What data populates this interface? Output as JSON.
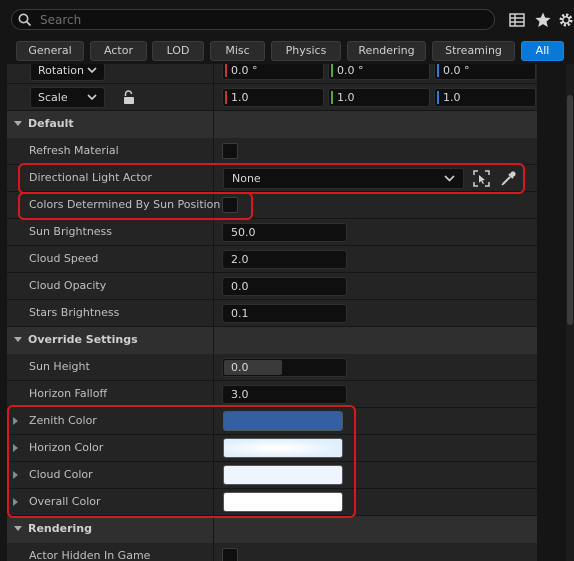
{
  "search": {
    "placeholder": "Search"
  },
  "tabs": [
    {
      "label": "General"
    },
    {
      "label": "Actor"
    },
    {
      "label": "LOD"
    },
    {
      "label": "Misc"
    },
    {
      "label": "Physics"
    },
    {
      "label": "Rendering"
    },
    {
      "label": "Streaming"
    },
    {
      "label": "All",
      "active": true
    }
  ],
  "transform": {
    "rotation": {
      "label": "Rotation",
      "values": [
        "0.0 °",
        "0.0 °",
        "0.0 °"
      ]
    },
    "scale": {
      "label": "Scale",
      "values": [
        "1.0",
        "1.0",
        "1.0"
      ]
    }
  },
  "default_section": {
    "title": "Default",
    "refresh_material": "Refresh Material",
    "directional_light_actor": {
      "label": "Directional Light Actor",
      "value": "None"
    },
    "colors_by_sun": "Colors Determined By Sun Position",
    "sun_brightness": {
      "label": "Sun Brightness",
      "value": "50.0"
    },
    "cloud_speed": {
      "label": "Cloud Speed",
      "value": "2.0"
    },
    "cloud_opacity": {
      "label": "Cloud Opacity",
      "value": "0.0"
    },
    "stars_brightness": {
      "label": "Stars Brightness",
      "value": "0.1"
    }
  },
  "override_section": {
    "title": "Override Settings",
    "sun_height": {
      "label": "Sun Height",
      "value": "0.0"
    },
    "horizon_falloff": {
      "label": "Horizon Falloff",
      "value": "3.0"
    },
    "zenith_color": {
      "label": "Zenith Color",
      "color": "#34609f"
    },
    "horizon_color": {
      "label": "Horizon Color",
      "color": "#dfeffe"
    },
    "cloud_color": {
      "label": "Cloud Color",
      "color": "#eef5fe"
    },
    "overall_color": {
      "label": "Overall Color",
      "color": "#ffffff"
    }
  },
  "rendering_section": {
    "title": "Rendering",
    "actor_hidden": "Actor Hidden In Game"
  },
  "icons": [
    "search-icon",
    "table-view-icon",
    "star-icon",
    "settings-gear-icon",
    "lock-icon",
    "pick-actor-icon",
    "eyedropper-icon",
    "reset-arrow-icon"
  ],
  "colors": {
    "accent": "#0a78d7",
    "highlight": "#d4191f",
    "x_axis": "#c8372f",
    "y_axis": "#5aa83a",
    "z_axis": "#3a78d6"
  }
}
